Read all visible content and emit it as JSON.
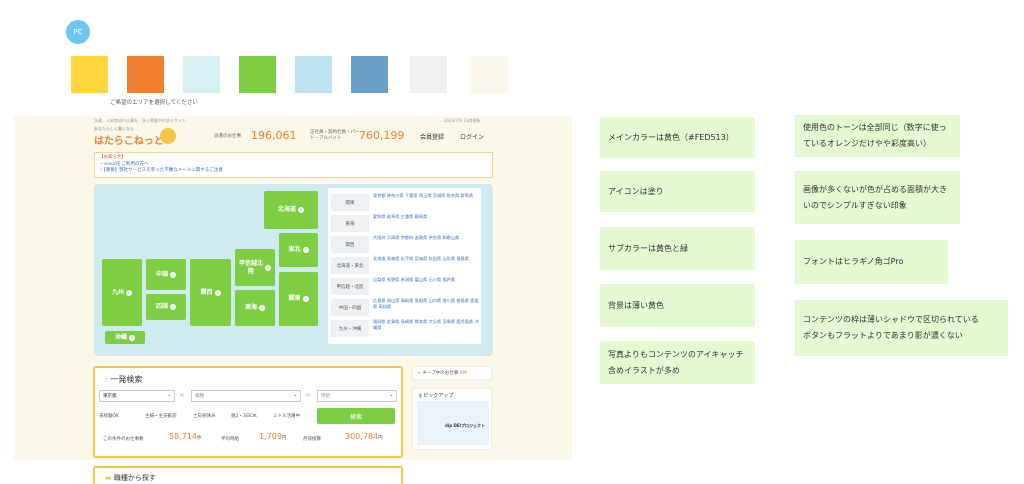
{
  "badge": "PC",
  "swatches": [
    "#FED53C",
    "#F07F2D",
    "#D6F0F3",
    "#7DCE43",
    "#BDE3F1",
    "#6BA0C8",
    "#F1F1F1",
    "#FBF6EA"
  ],
  "site": {
    "tagline": "派遣、人材育成の仕事を、多く掲載中の求人サイト",
    "logo_sub": "あなたらしく働くなら",
    "logo": "はたらこねっと",
    "dispatch_label": "派遣のお仕事",
    "dispatch_count": "196,061",
    "regular_label": "正社員・契約社員・パート・アルバイト",
    "regular_count": "760,199",
    "register": "会員登録",
    "login": "ログイン",
    "updated": "2024/7/9 11時更新",
    "notice_title": "【お知らせ】",
    "notice_1": "・icloudをご利用の方へ",
    "notice_2": "・【重要】弊社サービスを装った不審なメールに関するご注意",
    "map_prompt": "ご希望のエリアを選択してください",
    "regions": {
      "hokkaido": "北海道",
      "tohoku": "東北",
      "koshinetsu": "甲信越北陸",
      "kanto": "関東",
      "tokai": "東海",
      "kansai": "関西",
      "chugoku": "中国",
      "shikoku": "四国",
      "kyushu": "九州",
      "okinawa": "沖縄"
    },
    "pref_rows": [
      {
        "label": "関東",
        "prefs": "東京都 神奈川県 千葉県 埼玉県 茨城県 栃木県 群馬県"
      },
      {
        "label": "東海",
        "prefs": "愛知県 岐阜県 三重県 静岡県"
      },
      {
        "label": "関西",
        "prefs": "大阪府 兵庫県 京都府 滋賀県 奈良県 和歌山県"
      },
      {
        "label": "北海道・東北",
        "prefs": "北海道 青森県 岩手県 宮城県 秋田県 山形県 福島県"
      },
      {
        "label": "甲信越・北陸",
        "prefs": "山梨県 長野県 新潟県 富山県 石川県 福井県"
      },
      {
        "label": "中国・四国",
        "prefs": "広島県 岡山県 鳥取県 島根県 山口県 香川県 徳島県 愛媛県 高知県"
      },
      {
        "label": "九州・沖縄",
        "prefs": "福岡県 佐賀県 長崎県 熊本県 大分県 宮崎県 鹿児島県 沖縄県"
      }
    ],
    "search_title": "一発検索",
    "pref_select": "東京都",
    "job_select": "職種",
    "keyword_select": "時給",
    "checks": [
      "未経験OK",
      "主婦・主夫歓迎",
      "土日祝休み",
      "週2・3日OK",
      "ミドル活躍中"
    ],
    "search_button": "検索",
    "count_label": "この条件のお仕事数",
    "count_value": "58,714",
    "count_unit": "件",
    "hourly_label": "平均時給",
    "hourly_value": "1,709",
    "hourly_unit": "円",
    "monthly_label": "月収換算",
    "monthly_value": "300,784",
    "monthly_unit": "円",
    "keep_label": "キープ中のお仕事",
    "keep_count": "0件",
    "pickup": "ピックアップ",
    "pickup_text": "dip DEIプロジェクト",
    "job_search": "職種から探す"
  },
  "notes": [
    "メインカラーは黄色（#FED513）",
    "アイコンは塗り",
    "サブカラーは黄色と緑",
    "背景は薄い黄色",
    "写真よりもコンテンツのアイキャッチ含めイラストが多め",
    "使用色のトーンは全部同じ（数字に使っているオレンジだけやや彩度高い）",
    "画像が多くないが色が占める面積が大きいのでシンプルすぎない印象",
    "フォントはヒラギノ角ゴPro",
    "コンテンツの枠は薄いシャドウで区切られている",
    "ボタンもフラットよりであまり影が濃くない"
  ]
}
